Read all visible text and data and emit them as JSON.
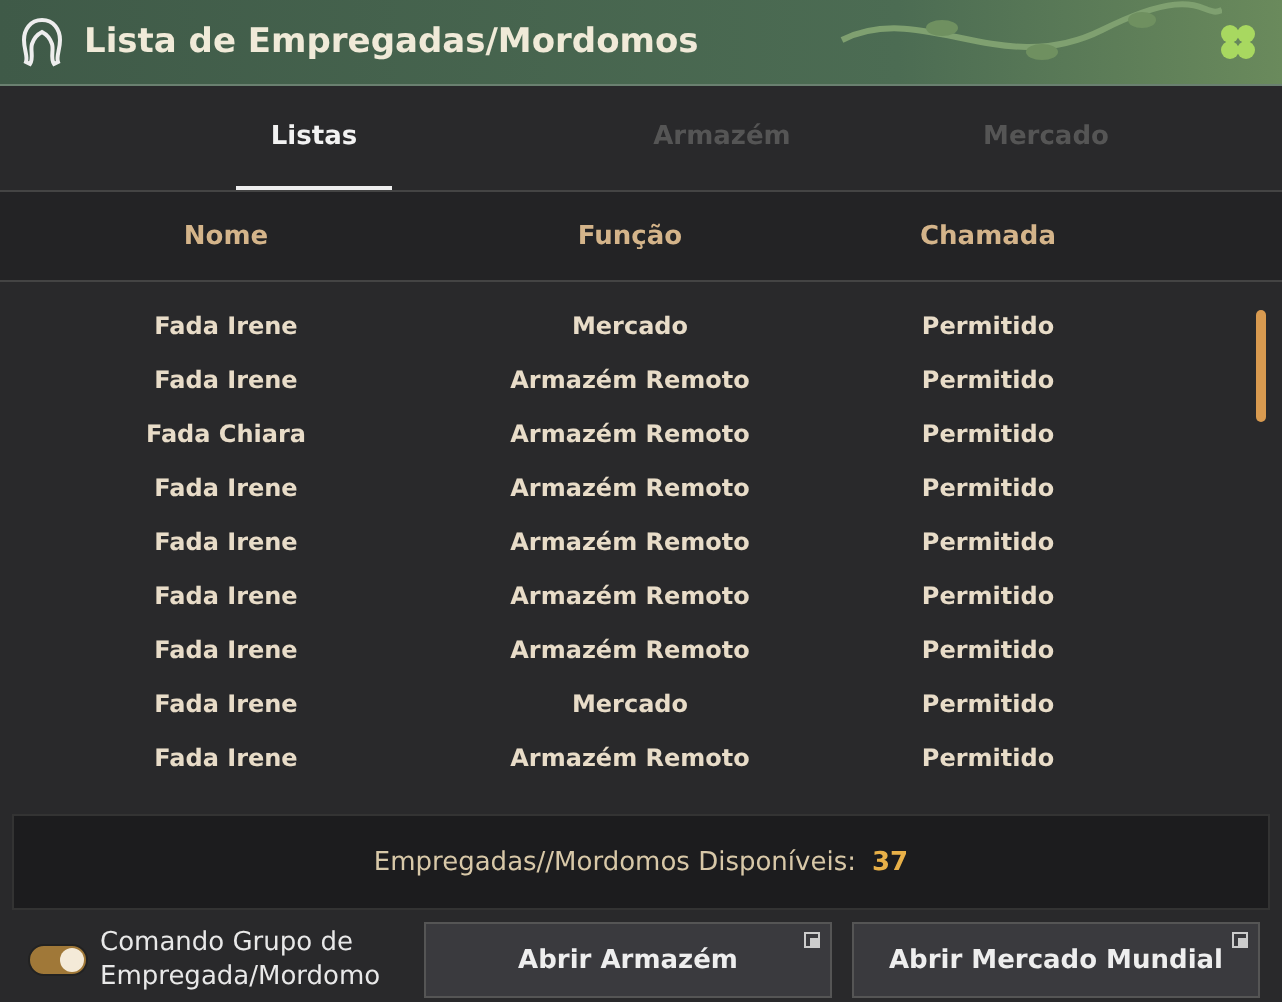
{
  "window": {
    "title": "Lista de Empregadas/Mordomos"
  },
  "tabs": [
    {
      "label": "Listas",
      "selected": true
    },
    {
      "label": "Armazém",
      "selected": false
    },
    {
      "label": "Mercado",
      "selected": false
    }
  ],
  "table": {
    "columns": [
      "Nome",
      "Função",
      "Chamada"
    ],
    "rows": [
      [
        "Fada Irene",
        "Mercado",
        "Permitido"
      ],
      [
        "Fada Irene",
        "Armazém Remoto",
        "Permitido"
      ],
      [
        "Fada Chiara",
        "Armazém Remoto",
        "Permitido"
      ],
      [
        "Fada Irene",
        "Armazém Remoto",
        "Permitido"
      ],
      [
        "Fada Irene",
        "Armazém Remoto",
        "Permitido"
      ],
      [
        "Fada Irene",
        "Armazém Remoto",
        "Permitido"
      ],
      [
        "Fada Irene",
        "Armazém Remoto",
        "Permitido"
      ],
      [
        "Fada Irene",
        "Mercado",
        "Permitido"
      ],
      [
        "Fada Irene",
        "Armazém Remoto",
        "Permitido"
      ]
    ]
  },
  "summary": {
    "label": "Empregadas//Mordomos Disponíveis:",
    "count": "37"
  },
  "group_command": {
    "label": "Comando Grupo de Empregada/Mordomo",
    "on": true
  },
  "buttons": [
    "Abrir Armazém",
    "Abrir Mercado Mundial"
  ]
}
